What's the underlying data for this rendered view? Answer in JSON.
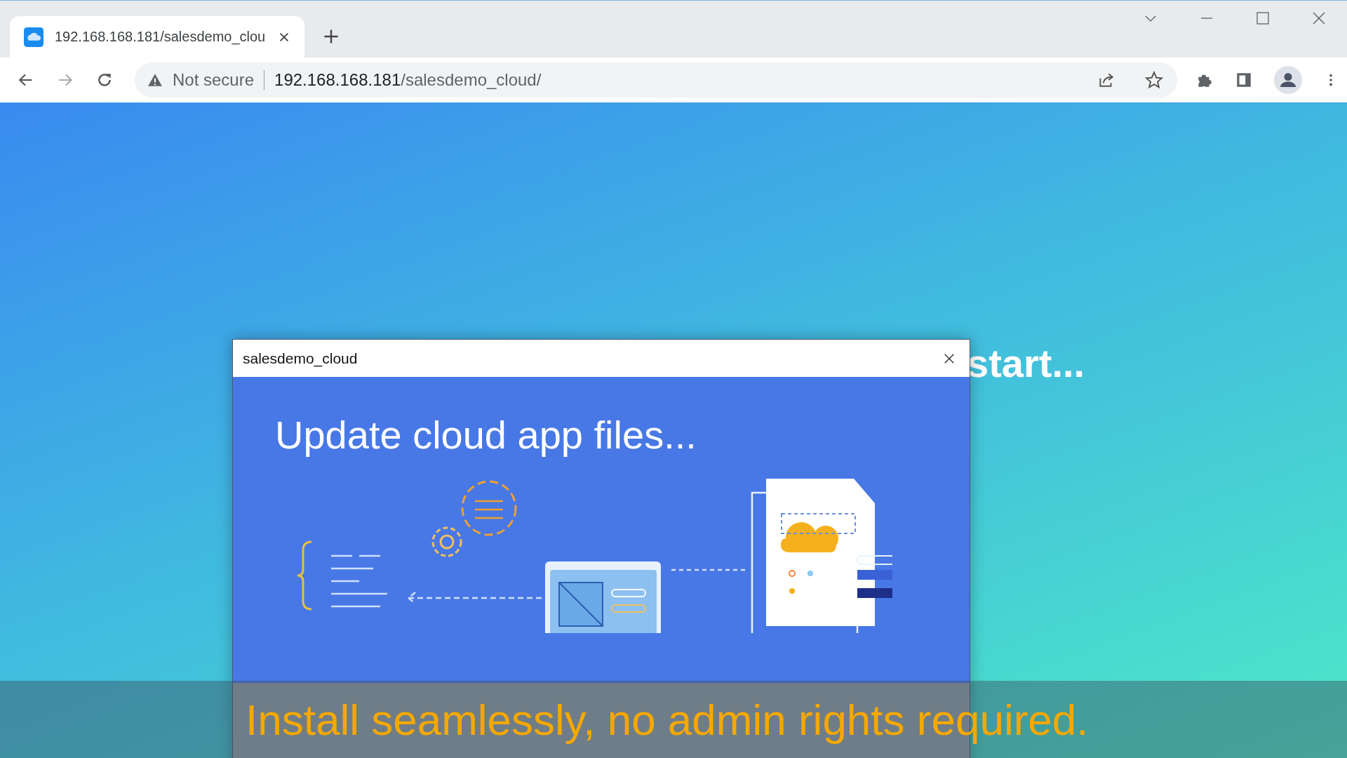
{
  "browser": {
    "tabs": [
      {
        "title": "192.168.168.181/salesdemo_clou",
        "selected": true
      }
    ],
    "address_bar": {
      "security": "Not secure",
      "url_host": "192.168.168.181",
      "url_path": "/salesdemo_cloud/"
    }
  },
  "page": {
    "background_heading": "start..."
  },
  "dialog": {
    "title": "salesdemo_cloud",
    "banner_heading": "Update cloud app files..."
  },
  "caption": "Install seamlessly, no admin rights required."
}
